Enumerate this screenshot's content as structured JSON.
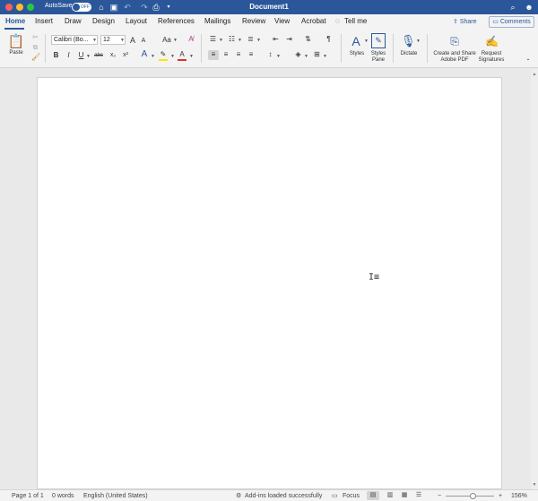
{
  "titlebar": {
    "autosave_label": "AutoSave",
    "autosave_state": "OFF",
    "document_title": "Document1",
    "icons": [
      "home-icon",
      "save-icon",
      "undo-icon",
      "redo-icon",
      "print-icon",
      "customize-toolbar-icon",
      "search-icon",
      "account-icon"
    ]
  },
  "tabs": {
    "items": [
      "Home",
      "Insert",
      "Draw",
      "Design",
      "Layout",
      "References",
      "Mailings",
      "Review",
      "View",
      "Acrobat",
      "Tell me"
    ],
    "active": "Home",
    "share_label": "Share",
    "comments_label": "Comments"
  },
  "ribbon": {
    "paste_label": "Paste",
    "font_name": "Calibri (Bo...",
    "font_size": "12",
    "grow_font": "A",
    "shrink_font": "A",
    "change_case": "Aa",
    "bold": "B",
    "italic": "I",
    "underline": "U",
    "strikethrough": "abc",
    "subscript": "x₂",
    "superscript": "x²",
    "show_formatting": "¶",
    "styles_label": "Styles",
    "styles_pane_label": "Styles Pane",
    "dictate_label": "Dictate",
    "create_pdf_label": "Create and Share Adobe PDF",
    "request_signatures_label": "Request Signatures",
    "colors": {
      "highlight": "#f7e600",
      "font_color": "#e03131",
      "accent": "#2b579a"
    }
  },
  "statusbar": {
    "page": "Page 1 of 1",
    "words": "0 words",
    "language": "English (United States)",
    "addins": "Add-ins loaded successfully",
    "focus": "Focus",
    "zoom": "156%",
    "zoom_minus": "−",
    "zoom_plus": "+"
  }
}
